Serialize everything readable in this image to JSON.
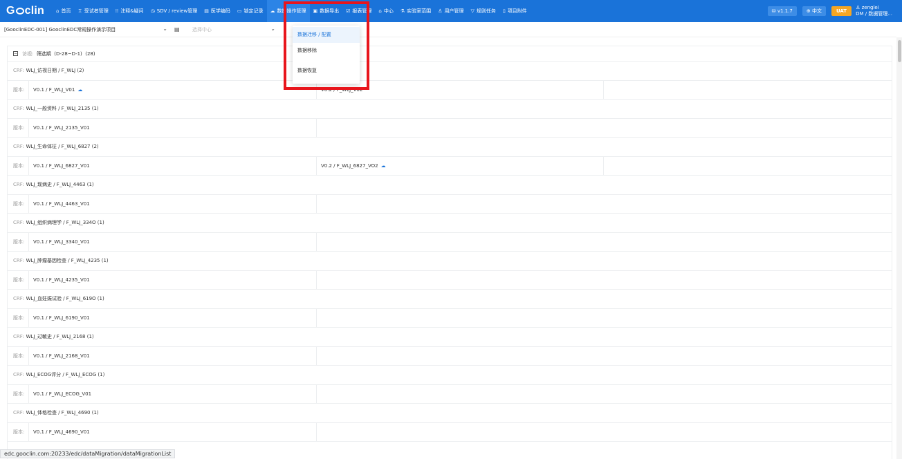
{
  "app": {
    "logo_before": "G",
    "logo_after": "clin"
  },
  "nav": [
    {
      "icon": "⌂",
      "icon_name": "home-icon",
      "label": "首页"
    },
    {
      "icon": "♖",
      "icon_name": "subject-icon",
      "label": "受试者管理"
    },
    {
      "icon": "⁞⁞",
      "icon_name": "annotation-icon",
      "label": "注释&疑问"
    },
    {
      "icon": "◷",
      "icon_name": "clock-icon",
      "label": "SDV / review管理"
    },
    {
      "icon": "▤",
      "icon_name": "document-icon",
      "label": "医学编码"
    },
    {
      "icon": "▭",
      "icon_name": "lock-record-icon",
      "label": "锁定记录"
    },
    {
      "icon": "☁",
      "icon_name": "cloud-icon",
      "label": "数据操作管理"
    },
    {
      "icon": "▣",
      "icon_name": "export-icon",
      "label": "数据导出"
    },
    {
      "icon": "☑",
      "icon_name": "report-icon",
      "label": "报表管理"
    },
    {
      "icon": "⌂",
      "icon_name": "center-icon",
      "label": "中心"
    },
    {
      "icon": "⚗",
      "icon_name": "lab-icon",
      "label": "实验室范围"
    },
    {
      "icon": "♙",
      "icon_name": "user-icon",
      "label": "用户管理"
    },
    {
      "icon": "▽",
      "icon_name": "filter-icon",
      "label": "规则任务"
    },
    {
      "icon": "▯",
      "icon_name": "attachment-icon",
      "label": "项目附件"
    }
  ],
  "tools": {
    "version": "v1.1.7",
    "language": "中文",
    "env": "UAT",
    "username": "zenglei",
    "role": "DM / 数据管理..."
  },
  "selector": {
    "project": "[GooclinEDC-001]  GooclinEDC常规操作演示项目",
    "center_placeholder": "选择中心"
  },
  "dropdown": [
    "数据迁移 / 配置",
    "数据移除",
    "数据恢复"
  ],
  "visit": {
    "prefix": "访视:",
    "name": "筛选期",
    "window": "(D-28~D-1)",
    "count": "(28)"
  },
  "labels": {
    "crf": "CRF:",
    "version": "版本:"
  },
  "crfs": [
    {
      "name": "WLJ_访视日期 / F_WLJ (2)",
      "versions": [
        "V0.1 / F_WLJ_V01",
        "V0.2 / F_WLJ_V02"
      ],
      "cloud": 0
    },
    {
      "name": "WLJ_一般资料 / F_WLJ_2135 (1)",
      "versions": [
        "V0.1 / F_WLJ_2135_V01"
      ],
      "cloud": -1
    },
    {
      "name": "WLJ_生命体征 / F_WLJ_6827 (2)",
      "versions": [
        "V0.1 / F_WLJ_6827_V01",
        "V0.2 / F_WLJ_6827_VO2"
      ],
      "cloud": 1
    },
    {
      "name": "WLJ_现病史 / F_WLJ_4463 (1)",
      "versions": [
        "V0.1 / F_WLJ_4463_V01"
      ],
      "cloud": -1
    },
    {
      "name": "WLJ_组织病理学 / F_WLJ_334O (1)",
      "versions": [
        "V0.1 / F_WLJ_3340_V01"
      ],
      "cloud": -1
    },
    {
      "name": "WLJ_肿瘤基因检查 / F_WLJ_4235 (1)",
      "versions": [
        "V0.1 / F_WLJ_4235_V01"
      ],
      "cloud": -1
    },
    {
      "name": "WLJ_血妊娠试验 / F_WLJ_619O (1)",
      "versions": [
        "V0.1 / F_WLJ_6190_V01"
      ],
      "cloud": -1
    },
    {
      "name": "WLJ_过敏史 / F_WLJ_2168 (1)",
      "versions": [
        "V0.1 / F_WLJ_2168_V01"
      ],
      "cloud": -1
    },
    {
      "name": "WLJ_ECOG评分 / F_WLJ_ECOG (1)",
      "versions": [
        "V0.1 / F_WLJ_ECOG_V01"
      ],
      "cloud": -1
    },
    {
      "name": "WLJ_体格检查 / F_WLJ_4690 (1)",
      "versions": [
        "V0.1 / F_WLJ_4690_V01"
      ],
      "cloud": -1
    }
  ],
  "status_url": "edc.gooclin.com:20233/edc/dataMigration/dataMigrationList"
}
